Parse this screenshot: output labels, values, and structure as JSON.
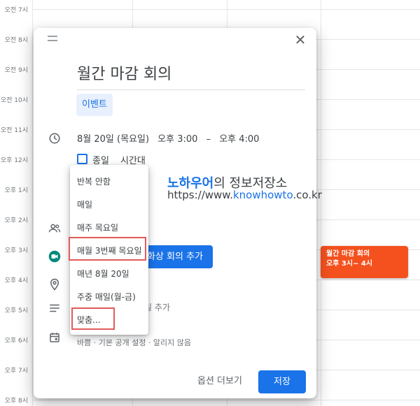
{
  "calendar": {
    "times": [
      "오전 7시",
      "오전 8시",
      "오전 9시",
      "오전 10시",
      "오전 11시",
      "오후 12시",
      "오후 1시",
      "오후 2시",
      "오후 3시",
      "오후 4시",
      "오후 5시",
      "오후 6시",
      "오후 7시",
      "오후 8시"
    ],
    "event": {
      "title": "월간 마감 회의",
      "time": "오후 3시~ 4시",
      "color": "#f4511e"
    }
  },
  "dialog": {
    "title": "월간 마감 회의",
    "type_chip": "이벤트",
    "date": "8월 20일 (목요일)",
    "start_time": "오후 3:00",
    "dash": "–",
    "end_time": "오후 4:00",
    "all_day_label": "종일",
    "timezone_label": "시간대",
    "add_meet_label": "화상 회의 추가",
    "description_partial": "일 추가",
    "calendar_status": "바쁨 · 기본 공개 설정 · 알리지 않음",
    "more_options": "옵션 더보기",
    "save": "저장"
  },
  "repeat_menu": {
    "items": [
      "반복 안함",
      "매일",
      "매주 목요일",
      "매월 3번째 목요일",
      "매년 8월 20일",
      "주중 매일(월-금)",
      "맞춤..."
    ],
    "highlighted": [
      "매월 3번째 목요일",
      "맞춤..."
    ],
    "highlight_color": "#e25a5a"
  },
  "watermark": {
    "brand_highlight": "노하우어",
    "brand_rest": "의 정보저장소",
    "url_prefix": "https://www.",
    "url_highlight": "knowhowto",
    "url_suffix": ".co.kr"
  },
  "colors": {
    "accent": "#1a73e8",
    "meet_green": "#00897b"
  }
}
